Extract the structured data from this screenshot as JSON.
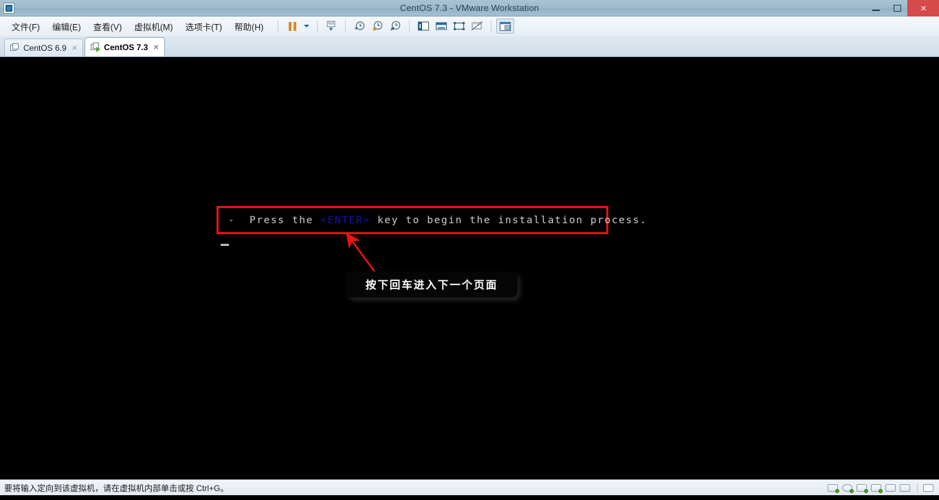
{
  "window": {
    "title": "CentOS 7.3 - VMware Workstation",
    "app_icon": "vmware-icon",
    "controls": {
      "minimize": "minimize-icon",
      "restore": "restore-icon",
      "close": "×"
    }
  },
  "menubar": {
    "items": [
      {
        "label": "文件(F)",
        "name": "menu-file"
      },
      {
        "label": "编辑(E)",
        "name": "menu-edit"
      },
      {
        "label": "查看(V)",
        "name": "menu-view"
      },
      {
        "label": "虚拟机(M)",
        "name": "menu-vm"
      },
      {
        "label": "选项卡(T)",
        "name": "menu-tabs"
      },
      {
        "label": "帮助(H)",
        "name": "menu-help"
      }
    ]
  },
  "toolbar": {
    "buttons": [
      {
        "name": "suspend-button",
        "icon": "pause-icon"
      },
      {
        "name": "power-dropdown-button",
        "icon": "chevron-down-icon"
      },
      {
        "name": "take-snapshot-button",
        "icon": "snapshot-icon"
      },
      {
        "name": "snapshot-add-button",
        "icon": "clock-plus-icon"
      },
      {
        "name": "revert-snapshot-button",
        "icon": "clock-revert-icon"
      },
      {
        "name": "snapshot-manager-button",
        "icon": "clock-wrench-icon"
      },
      {
        "name": "show-library-button",
        "icon": "sidebar-icon"
      },
      {
        "name": "show-console-view-button",
        "icon": "console-view-icon"
      },
      {
        "name": "enter-fullscreen-button",
        "icon": "fullscreen-icon"
      },
      {
        "name": "unity-mode-button",
        "icon": "unity-disabled-icon"
      },
      {
        "name": "show-thumbnails-button",
        "icon": "thumbnail-bar-icon"
      }
    ]
  },
  "tabs": [
    {
      "label": "CentOS 6.9",
      "active": false,
      "running": false,
      "close": "×"
    },
    {
      "label": "CentOS 7.3",
      "active": true,
      "running": true,
      "close": "×"
    }
  ],
  "console": {
    "prefix": "-  Press the ",
    "key": "<ENTER>",
    "suffix": " key to begin the installation process.",
    "cursor": "block-cursor",
    "highlight_color": "#e81313",
    "key_color": "#1414b8",
    "text_color": "#cfcfcf"
  },
  "annotation": {
    "tooltip_text": "按下回车进入下一个页面",
    "arrow": "red-arrow",
    "arrow_color": "#e81313"
  },
  "statusbar": {
    "message": "要将输入定向到该虚拟机，请在虚拟机内部单击或按 Ctrl+G。",
    "devices": [
      {
        "name": "status-hard-disk-icon"
      },
      {
        "name": "status-cd-dvd-icon"
      },
      {
        "name": "status-network-adapter-1-icon"
      },
      {
        "name": "status-network-adapter-2-icon"
      },
      {
        "name": "status-printer-icon"
      },
      {
        "name": "status-display-icon"
      },
      {
        "name": "status-message-log-icon"
      }
    ]
  }
}
